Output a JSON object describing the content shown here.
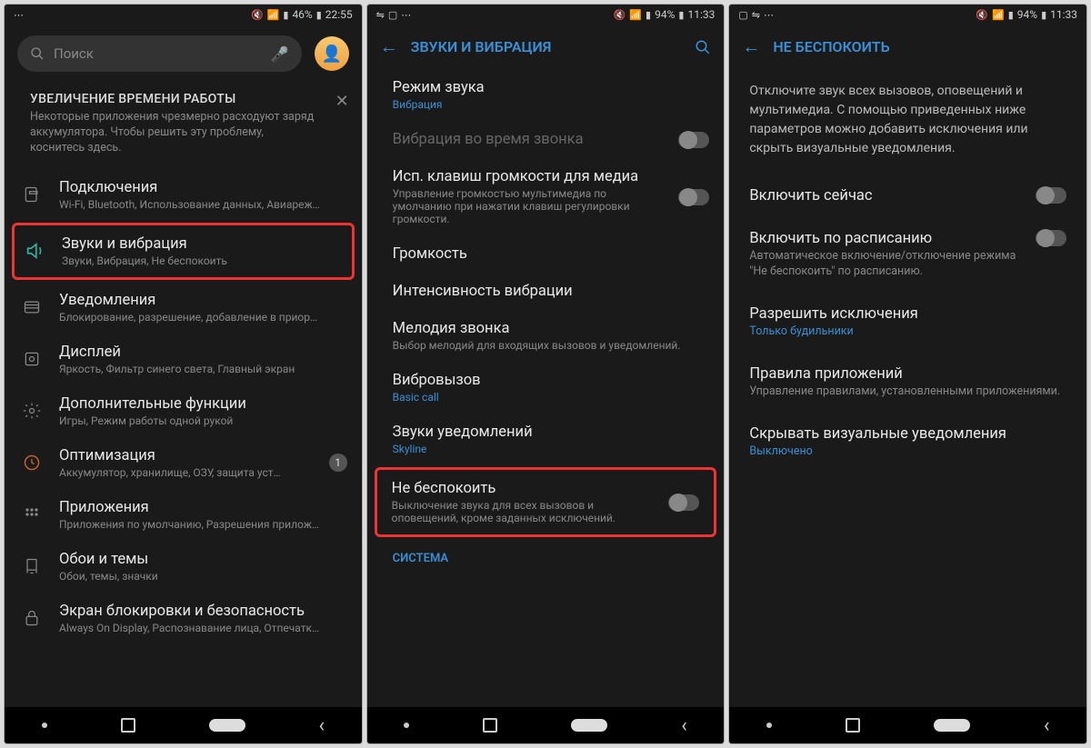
{
  "screen1": {
    "status": {
      "battery": "46%",
      "time": "22:55"
    },
    "search_placeholder": "Поиск",
    "tip": {
      "title": "УВЕЛИЧЕНИЕ ВРЕМЕНИ РАБОТЫ",
      "text": "Некоторые приложения чрезмерно расходуют заряд аккумулятора. Чтобы решить эту проблему, коснитесь здесь."
    },
    "items": [
      {
        "title": "Подключения",
        "sub": "Wi-Fi, Bluetooth, Использование данных, Авиареж…"
      },
      {
        "title": "Звуки и вибрация",
        "sub": "Звуки, Вибрация, Не беспокоить"
      },
      {
        "title": "Уведомления",
        "sub": "Блокирование, разрешение, добавление в приор…"
      },
      {
        "title": "Дисплей",
        "sub": "Яркость, Фильтр синего света, Главный экран"
      },
      {
        "title": "Дополнительные функции",
        "sub": "Игры, Режим работы одной рукой"
      },
      {
        "title": "Оптимизация",
        "sub": "Аккумулятор, хранилище, ОЗУ, защита уст…",
        "badge": "1"
      },
      {
        "title": "Приложения",
        "sub": "Приложения по умолчанию, Разрешения прилож…"
      },
      {
        "title": "Обои и темы",
        "sub": "Обои, темы, значки"
      },
      {
        "title": "Экран блокировки и безопасность",
        "sub": "Always On Display, Распознавание лица, Отпечатк…"
      }
    ]
  },
  "screen2": {
    "status": {
      "battery": "94%",
      "time": "11:33"
    },
    "title": "ЗВУКИ И ВИБРАЦИЯ",
    "items": [
      {
        "title": "Режим звука",
        "sub": "Вибрация",
        "subClass": "blue"
      },
      {
        "title": "Вибрация во время звонка",
        "dim": true,
        "toggle": true
      },
      {
        "title": "Исп. клавиш громкости для медиа",
        "sub": "Управление громкостью мультимедиа по умолчанию при нажатии клавиш регулировки громкости.",
        "toggle": true
      },
      {
        "title": "Громкость"
      },
      {
        "title": "Интенсивность вибрации"
      },
      {
        "title": "Мелодия звонка",
        "sub": "Выбор мелодий для входящих вызовов и уведомлений."
      },
      {
        "title": "Вибровызов",
        "sub": "Basic call",
        "subClass": "blue"
      },
      {
        "title": "Звуки уведомлений",
        "sub": "Skyline",
        "subClass": "blue"
      },
      {
        "title": "Не беспокоить",
        "sub": "Выключение звука для всех вызовов и оповещений, кроме заданных исключений.",
        "toggle": true
      }
    ],
    "section": "СИСТЕМА"
  },
  "screen3": {
    "status": {
      "battery": "94%",
      "time": "11:33"
    },
    "title": "НЕ БЕСПОКОИТЬ",
    "intro": "Отключите звук всех вызовов, оповещений и мультимедиа. С помощью приведенных ниже параметров можно добавить исключения или скрыть визуальные уведомления.",
    "items": [
      {
        "title": "Включить сейчас",
        "toggle": true
      },
      {
        "title": "Включить по расписанию",
        "sub": "Автоматическое включение/отключение режима \"Не беспокоить\" по расписанию.",
        "toggle": true
      },
      {
        "title": "Разрешить исключения",
        "sub": "Только будильники",
        "subClass": "blue"
      },
      {
        "title": "Правила приложений",
        "sub": "Управление правилами, установленными приложениями."
      },
      {
        "title": "Скрывать визуальные уведомления",
        "sub": "Выключено",
        "subClass": "blue"
      }
    ]
  }
}
